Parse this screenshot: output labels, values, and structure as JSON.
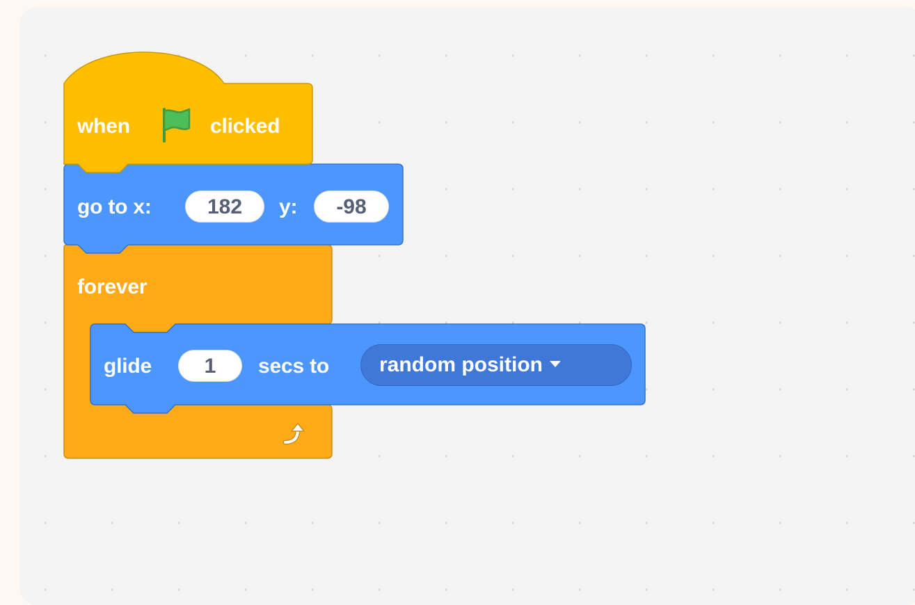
{
  "workspace": {
    "background_color": "#f4f4f4",
    "page_background": "#fff7f1"
  },
  "colors": {
    "events": "#ffbf00",
    "events_border": "#cc9900",
    "motion": "#4c97ff",
    "motion_border": "#3373cc",
    "control": "#ffab19",
    "control_border": "#cf8b17",
    "flag": "#4cbf56"
  },
  "blocks": {
    "hat": {
      "label_when": "when",
      "flag_icon": "green-flag-icon",
      "label_clicked": "clicked"
    },
    "goto": {
      "label_x": "go to x:",
      "x_value": "182",
      "label_y": "y:",
      "y_value": "-98"
    },
    "forever": {
      "label": "forever",
      "loop_icon": "loop-arrow-icon"
    },
    "glide": {
      "label_glide": "glide",
      "secs_value": "1",
      "label_secs": "secs to",
      "target": "random position"
    }
  }
}
